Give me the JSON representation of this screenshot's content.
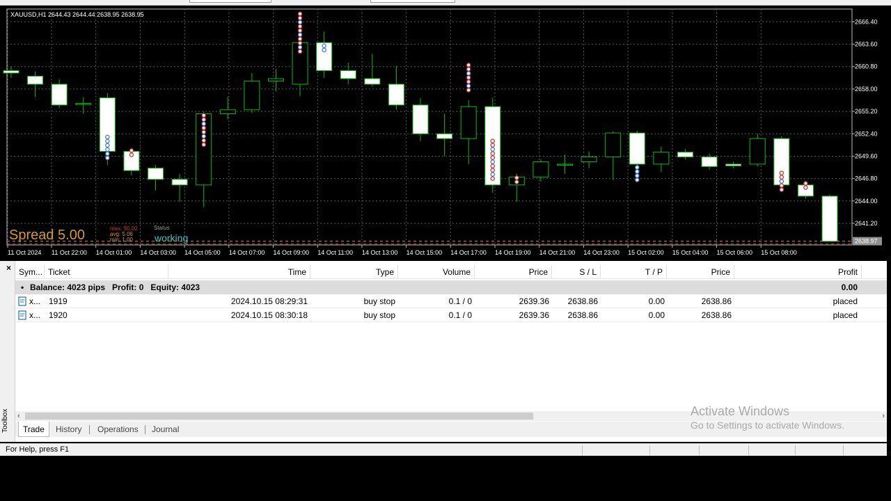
{
  "chart": {
    "symbol_header": "XAUUSD,H1  2644.43 2644.44 2638.95 2638.95",
    "price_labels": [
      "2666.40",
      "2663.60",
      "2660.80",
      "2658.00",
      "2655.20",
      "2652.40",
      "2649.60",
      "2646.80",
      "2644.00",
      "2641.20"
    ],
    "current_price": "2638.97",
    "time_labels": [
      "11 Oct 2024",
      "11 Oct 22:00",
      "14 Oct 01:00",
      "14 Oct 03:00",
      "14 Oct 05:00",
      "14 Oct 07:00",
      "14 Oct 09:00",
      "14 Oct 11:00",
      "14 Oct 13:00",
      "14 Oct 15:00",
      "14 Oct 17:00",
      "14 Oct 19:00",
      "14 Oct 21:00",
      "14 Oct 23:00",
      "15 Oct 02:00",
      "15 Oct 04:00",
      "15 Oct 06:00",
      "15 Oct 08:00"
    ],
    "spread_text": "Spread 5.00",
    "spread_stats": [
      "max: 50.00",
      "avg:  5.06",
      "min:  1.00"
    ],
    "status_label": "Status",
    "status_value": "working",
    "colors": {
      "background": "#000000",
      "bull_body": "#000000",
      "bear_body": "#ffffff",
      "candle_outline": "#00c000",
      "grid": "#5a5a5a",
      "spread": "#d49a2a",
      "status": "#3cc8c8"
    }
  },
  "chart_data": {
    "type": "candlestick",
    "title": "XAUUSD,H1",
    "ylim": [
      2638.5,
      2668.0
    ],
    "candles": [
      {
        "o": 2660.3,
        "h": 2660.8,
        "l": 2659.4,
        "c": 2660.0
      },
      {
        "o": 2659.6,
        "h": 2660.2,
        "l": 2657.0,
        "c": 2658.6
      },
      {
        "o": 2658.6,
        "h": 2659.2,
        "l": 2655.6,
        "c": 2656.0
      },
      {
        "o": 2656.1,
        "h": 2657.0,
        "l": 2654.9,
        "c": 2656.2
      },
      {
        "o": 2656.9,
        "h": 2657.5,
        "l": 2648.5,
        "c": 2650.2
      },
      {
        "o": 2650.2,
        "h": 2650.6,
        "l": 2647.2,
        "c": 2647.8
      },
      {
        "o": 2648.1,
        "h": 2648.5,
        "l": 2645.3,
        "c": 2646.7
      },
      {
        "o": 2646.7,
        "h": 2647.4,
        "l": 2643.9,
        "c": 2646.0
      },
      {
        "o": 2646.0,
        "h": 2655.2,
        "l": 2643.2,
        "c": 2654.9
      },
      {
        "o": 2654.9,
        "h": 2657.0,
        "l": 2654.2,
        "c": 2655.4
      },
      {
        "o": 2655.4,
        "h": 2660.0,
        "l": 2655.0,
        "c": 2659.0
      },
      {
        "o": 2659.0,
        "h": 2660.5,
        "l": 2657.7,
        "c": 2659.3
      },
      {
        "o": 2658.6,
        "h": 2664.6,
        "l": 2657.1,
        "c": 2663.8
      },
      {
        "o": 2663.8,
        "h": 2665.2,
        "l": 2659.4,
        "c": 2660.3
      },
      {
        "o": 2660.3,
        "h": 2661.3,
        "l": 2658.6,
        "c": 2659.3
      },
      {
        "o": 2659.3,
        "h": 2662.4,
        "l": 2658.3,
        "c": 2658.6
      },
      {
        "o": 2658.6,
        "h": 2660.9,
        "l": 2655.4,
        "c": 2656.0
      },
      {
        "o": 2656.0,
        "h": 2656.9,
        "l": 2651.5,
        "c": 2652.4
      },
      {
        "o": 2652.4,
        "h": 2654.9,
        "l": 2649.6,
        "c": 2651.8
      },
      {
        "o": 2651.8,
        "h": 2656.6,
        "l": 2648.6,
        "c": 2655.8
      },
      {
        "o": 2655.8,
        "h": 2656.9,
        "l": 2645.0,
        "c": 2646.0
      },
      {
        "o": 2646.0,
        "h": 2647.4,
        "l": 2643.9,
        "c": 2647.0
      },
      {
        "o": 2647.0,
        "h": 2649.2,
        "l": 2646.4,
        "c": 2648.9
      },
      {
        "o": 2648.5,
        "h": 2649.8,
        "l": 2647.4,
        "c": 2648.6
      },
      {
        "o": 2648.9,
        "h": 2650.2,
        "l": 2648.1,
        "c": 2649.5
      },
      {
        "o": 2649.5,
        "h": 2652.7,
        "l": 2646.6,
        "c": 2652.5
      },
      {
        "o": 2652.5,
        "h": 2652.8,
        "l": 2648.1,
        "c": 2648.6
      },
      {
        "o": 2648.6,
        "h": 2650.8,
        "l": 2647.6,
        "c": 2650.1
      },
      {
        "o": 2650.1,
        "h": 2650.5,
        "l": 2649.2,
        "c": 2649.5
      },
      {
        "o": 2649.5,
        "h": 2649.9,
        "l": 2647.9,
        "c": 2648.3
      },
      {
        "o": 2648.6,
        "h": 2648.9,
        "l": 2648.1,
        "c": 2648.4
      },
      {
        "o": 2648.6,
        "h": 2652.4,
        "l": 2648.3,
        "c": 2651.8
      },
      {
        "o": 2651.8,
        "h": 2652.1,
        "l": 2645.6,
        "c": 2646.0
      },
      {
        "o": 2646.0,
        "h": 2646.3,
        "l": 2644.3,
        "c": 2644.6
      },
      {
        "o": 2644.6,
        "h": 2644.8,
        "l": 2638.9,
        "c": 2638.95
      }
    ]
  },
  "terminal": {
    "close_icon": "close-icon",
    "toolbox_label": "Toolbox",
    "columns": [
      "Sym...",
      "Ticket",
      "Time",
      "Type",
      "Volume",
      "Price",
      "S / L",
      "T / P",
      "Price",
      "Profit"
    ],
    "balance": {
      "text": "Balance: 4023 pips   Profit: 0   Equity: 4023",
      "profit": "0.00"
    },
    "orders": [
      {
        "symbol": "x...",
        "ticket": "1919",
        "time": "2024.10.15 08:29:31",
        "type": "buy stop",
        "volume": "0.1 / 0",
        "price": "2639.36",
        "sl": "2638.86",
        "tp": "0.00",
        "cur_price": "2638.86",
        "profit": "placed"
      },
      {
        "symbol": "x...",
        "ticket": "1920",
        "time": "2024.10.15 08:30:18",
        "type": "buy stop",
        "volume": "0.1 / 0",
        "price": "2639.36",
        "sl": "2638.86",
        "tp": "0.00",
        "cur_price": "2638.86",
        "profit": "placed"
      }
    ],
    "tabs": [
      "Trade",
      "History",
      "Operations",
      "Journal"
    ],
    "active_tab": "Trade"
  },
  "watermark": {
    "title": "Activate Windows",
    "subtitle": "Go to Settings to activate Windows."
  },
  "statusbar": {
    "help_text": "For Help, press F1"
  }
}
